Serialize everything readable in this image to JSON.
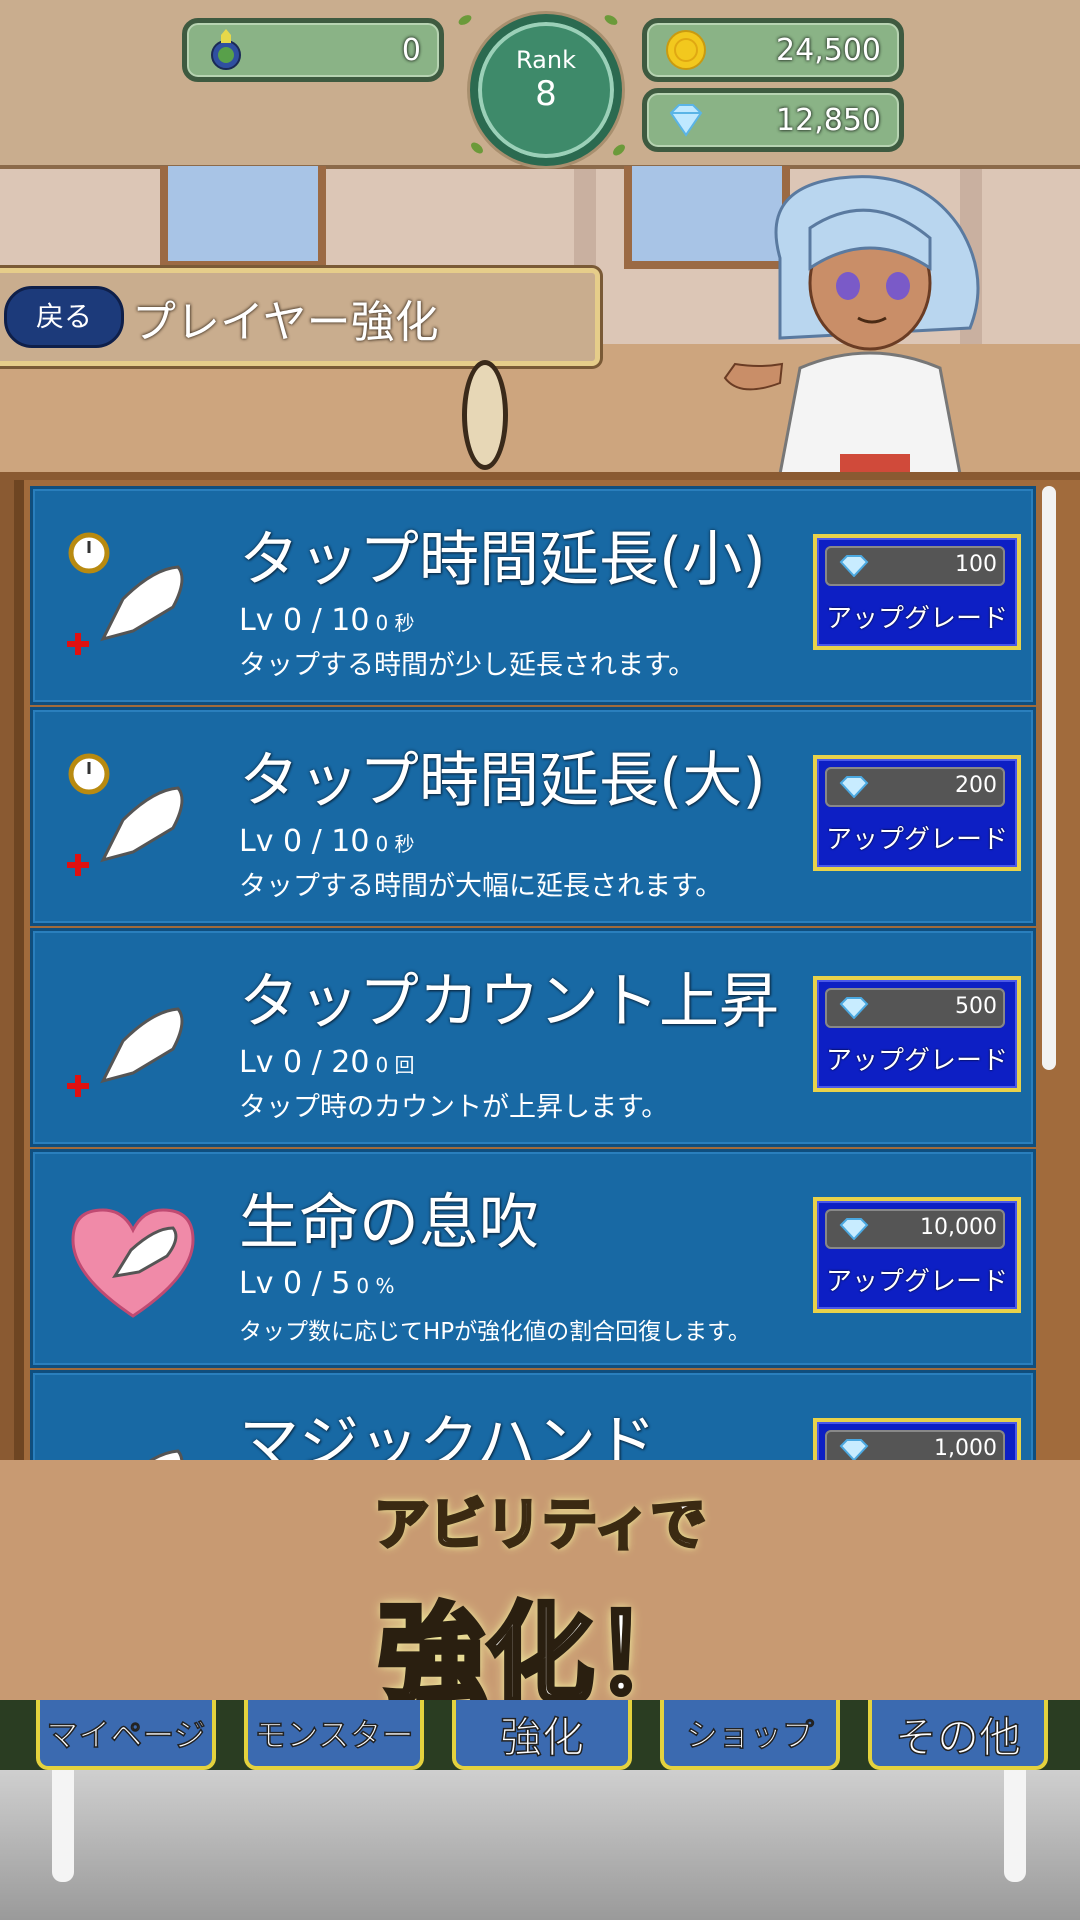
{
  "topbar": {
    "potion_value": "0",
    "rank_label": "Rank",
    "rank_value": "8",
    "gold_value": "24,500",
    "gem_value": "12,850"
  },
  "header": {
    "back_label": "戻る",
    "title": "プレイヤー強化"
  },
  "upgrades": [
    {
      "name": "タップ時間延長(小)",
      "level": "Lv 0 / 10",
      "level_unit": "0 秒",
      "desc": "タップする時間が少し延長されます。",
      "price": "100",
      "button": "アップグレード",
      "icon": "hand-timer-icon"
    },
    {
      "name": "タップ時間延長(大)",
      "level": "Lv 0 / 10",
      "level_unit": "0 秒",
      "desc": "タップする時間が大幅に延長されます。",
      "price": "200",
      "button": "アップグレード",
      "icon": "hand-timer-icon"
    },
    {
      "name": "タップカウント上昇",
      "level": "Lv 0 / 20",
      "level_unit": "0 回",
      "desc": "タップ時のカウントが上昇します。",
      "price": "500",
      "button": "アップグレード",
      "icon": "hand-plus-icon"
    },
    {
      "name": "生命の息吹",
      "level": "Lv 0 / 5",
      "level_unit": "0 %",
      "desc": "タップ数に応じてHPが強化値の割合回復します。",
      "price": "10,000",
      "button": "アップグレード",
      "icon": "heart-hand-icon"
    },
    {
      "name": "マジックハンド",
      "price": "1,000",
      "icon": "hand-icon"
    }
  ],
  "banner": {
    "line1": "アビリティで",
    "line2": "強化！"
  },
  "nav": {
    "tabs": [
      "マイページ",
      "モンスター",
      "強化",
      "ショップ",
      "その他"
    ]
  },
  "colors": {
    "card_bg": "#1869a4",
    "upgrade_button": "#0d1fc4",
    "accent_gold": "#e8d24a"
  }
}
